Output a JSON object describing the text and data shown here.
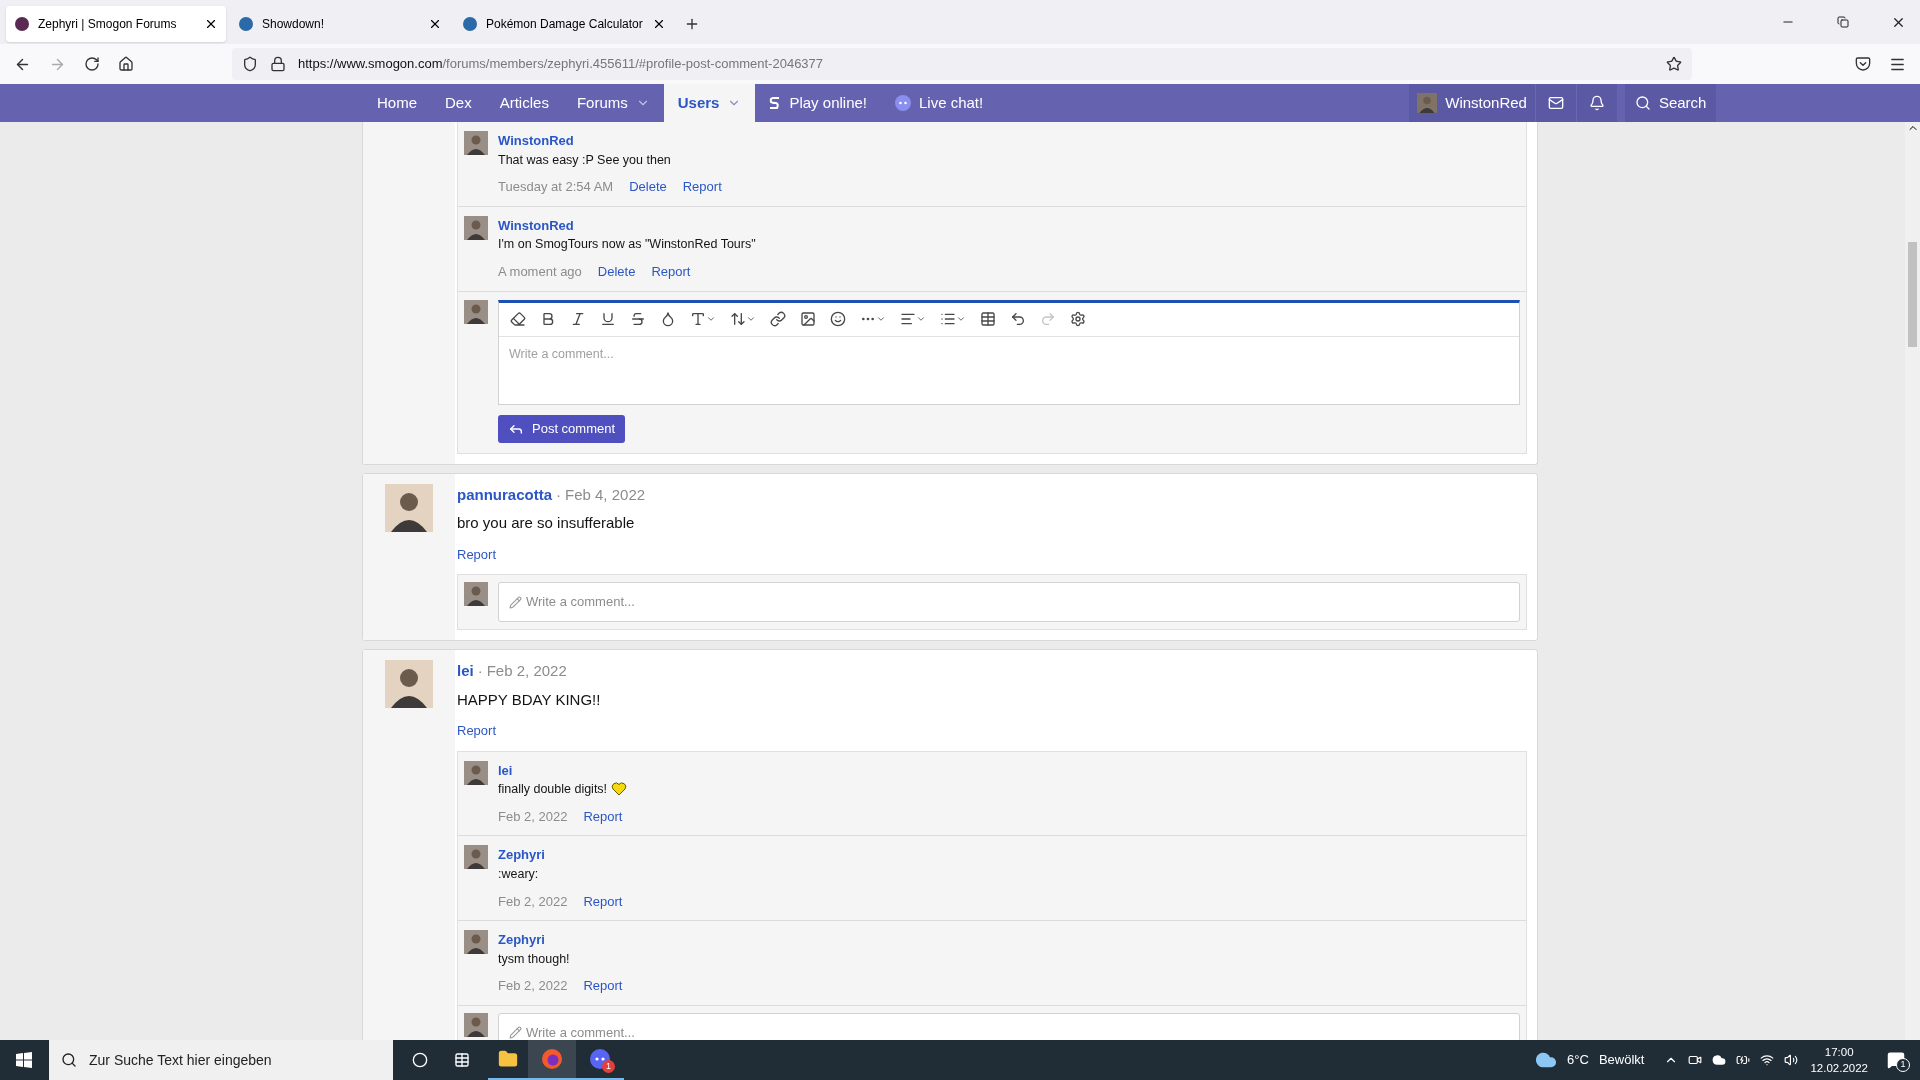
{
  "browser": {
    "tabs": [
      {
        "title": "Zephyri | Smogon Forums",
        "selected": true
      },
      {
        "title": "Showdown!",
        "selected": false
      },
      {
        "title": "Pokémon Damage Calculator",
        "selected": false
      }
    ],
    "url_host": "https://www.smogon.com",
    "url_path": "/forums/members/zephyri.455611/#profile-post-comment-2046377"
  },
  "nav": {
    "items": [
      {
        "label": "Home",
        "selected": false,
        "menu": false,
        "kind": "plain"
      },
      {
        "label": "Dex",
        "selected": false,
        "menu": false,
        "kind": "plain"
      },
      {
        "label": "Articles",
        "selected": false,
        "menu": false,
        "kind": "plain"
      },
      {
        "label": "Forums",
        "selected": false,
        "menu": true,
        "kind": "plain"
      },
      {
        "label": "Users",
        "selected": true,
        "menu": true,
        "kind": "plain"
      },
      {
        "label": "Play online!",
        "selected": false,
        "menu": false,
        "kind": "showdown"
      },
      {
        "label": "Live chat!",
        "selected": false,
        "menu": false,
        "kind": "chat"
      }
    ],
    "user": "WinstonRed",
    "search": "Search"
  },
  "posts": [
    {
      "comments": [
        {
          "author": "WinstonRed",
          "text": "That was easy :P See you then",
          "time": "Tuesday at 2:54 AM",
          "actions": [
            "Delete",
            "Report"
          ]
        },
        {
          "author": "WinstonRed",
          "text": "I'm on SmogTours now as \"WinstonRed Tours\"",
          "time": "A moment ago",
          "actions": [
            "Delete",
            "Report"
          ]
        }
      ],
      "reply": {
        "kind": "editor",
        "placeholder": "Write a comment...",
        "button": "Post comment",
        "redo_disabled": true
      }
    },
    {
      "author": "pannuracotta",
      "separator": "·",
      "date": "Feb 4, 2022",
      "text": "bro you are so insufferable",
      "actions": [
        "Report"
      ],
      "reply": {
        "kind": "field",
        "placeholder": "Write a comment..."
      }
    },
    {
      "author": "lei",
      "separator": "·",
      "date": "Feb 2, 2022",
      "text": "HAPPY BDAY KING!!",
      "actions": [
        "Report"
      ],
      "comments": [
        {
          "author": "lei",
          "text": "finally double digits!",
          "emoji": true,
          "time": "Feb 2, 2022",
          "actions": [
            "Report"
          ]
        },
        {
          "author": "Zephyri",
          "text": ":weary:",
          "emoji": false,
          "time": "Feb 2, 2022",
          "actions": [
            "Report"
          ]
        },
        {
          "author": "Zephyri",
          "text": "tysm though!",
          "emoji": false,
          "time": "Feb 2, 2022",
          "actions": [
            "Report"
          ]
        }
      ],
      "reply": {
        "kind": "field",
        "placeholder": "Write a comment..."
      }
    }
  ],
  "taskbar": {
    "search_placeholder": "Zur Suche Text hier eingeben",
    "chat_badge": "1",
    "temperature": "6°C",
    "weather": "Bewölkt",
    "time": "17:00",
    "date": "12.02.2022",
    "notification_badge": "1"
  }
}
